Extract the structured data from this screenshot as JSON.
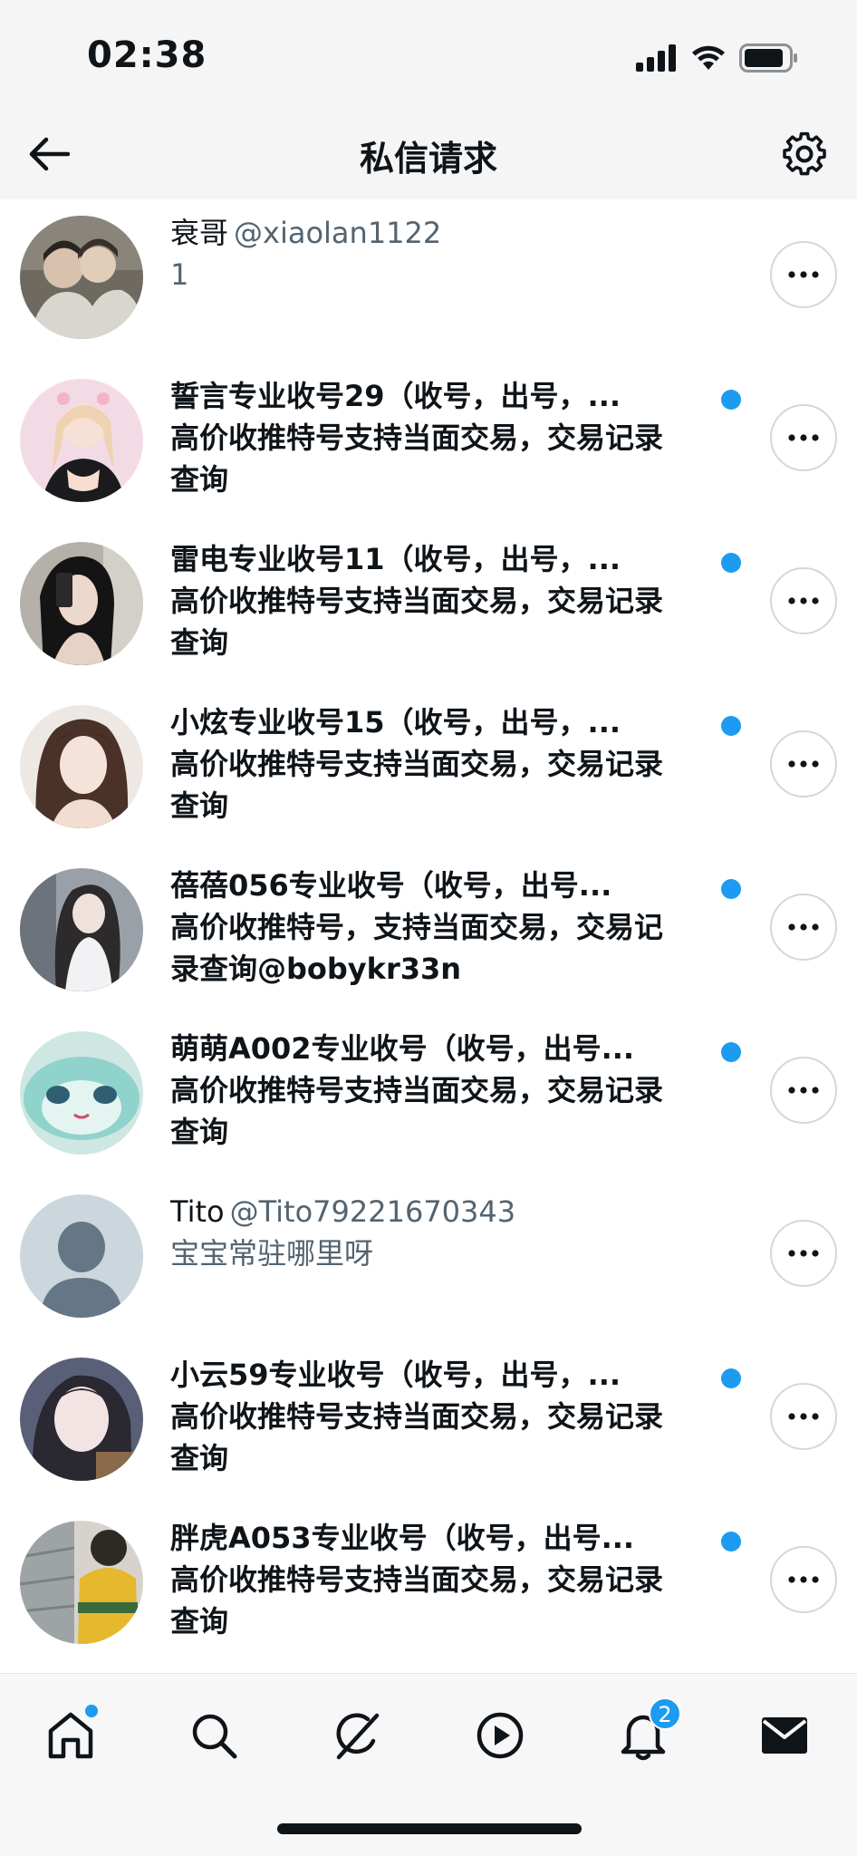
{
  "status": {
    "time": "02:38"
  },
  "nav": {
    "title": "私信请求"
  },
  "requests": [
    {
      "name": "衰哥",
      "handle": "@xiaolan1122",
      "snippet": [
        "1"
      ],
      "unread": false
    },
    {
      "name": "誓言专业收号29（收号，出号，...",
      "handle": "",
      "snippet": [
        "高价收推特号支持当面交易，交易记录",
        "查询"
      ],
      "unread": true
    },
    {
      "name": "雷电专业收号11（收号，出号，...",
      "handle": "",
      "snippet": [
        "高价收推特号支持当面交易，交易记录",
        "查询"
      ],
      "unread": true
    },
    {
      "name": "小炫专业收号15（收号，出号，...",
      "handle": "",
      "snippet": [
        "高价收推特号支持当面交易，交易记录",
        "查询"
      ],
      "unread": true
    },
    {
      "name": "蓓蓓056专业收号（收号，出号...",
      "handle": "",
      "snippet": [
        "高价收推特号，支持当面交易，交易记",
        "录查询@bobykr33n"
      ],
      "unread": true
    },
    {
      "name": "萌萌A002专业收号（收号，出号...",
      "handle": "",
      "snippet": [
        "高价收推特号支持当面交易，交易记录",
        "查询"
      ],
      "unread": true
    },
    {
      "name": "Tito",
      "handle": "@Tito79221670343",
      "snippet": [
        "宝宝常驻哪里呀"
      ],
      "unread": false
    },
    {
      "name": "小云59专业收号（收号，出号，...",
      "handle": "",
      "snippet": [
        "高价收推特号支持当面交易，交易记录",
        "查询"
      ],
      "unread": true
    },
    {
      "name": "胖虎A053专业收号（收号，出号...",
      "handle": "",
      "snippet": [
        "高价收推特号支持当面交易，交易记录",
        "查询"
      ],
      "unread": true
    }
  ],
  "tabs": {
    "notifications_badge": "2"
  },
  "colors": {
    "accent": "#1d9bf0",
    "text": "#0f1419",
    "secondary": "#536471"
  }
}
